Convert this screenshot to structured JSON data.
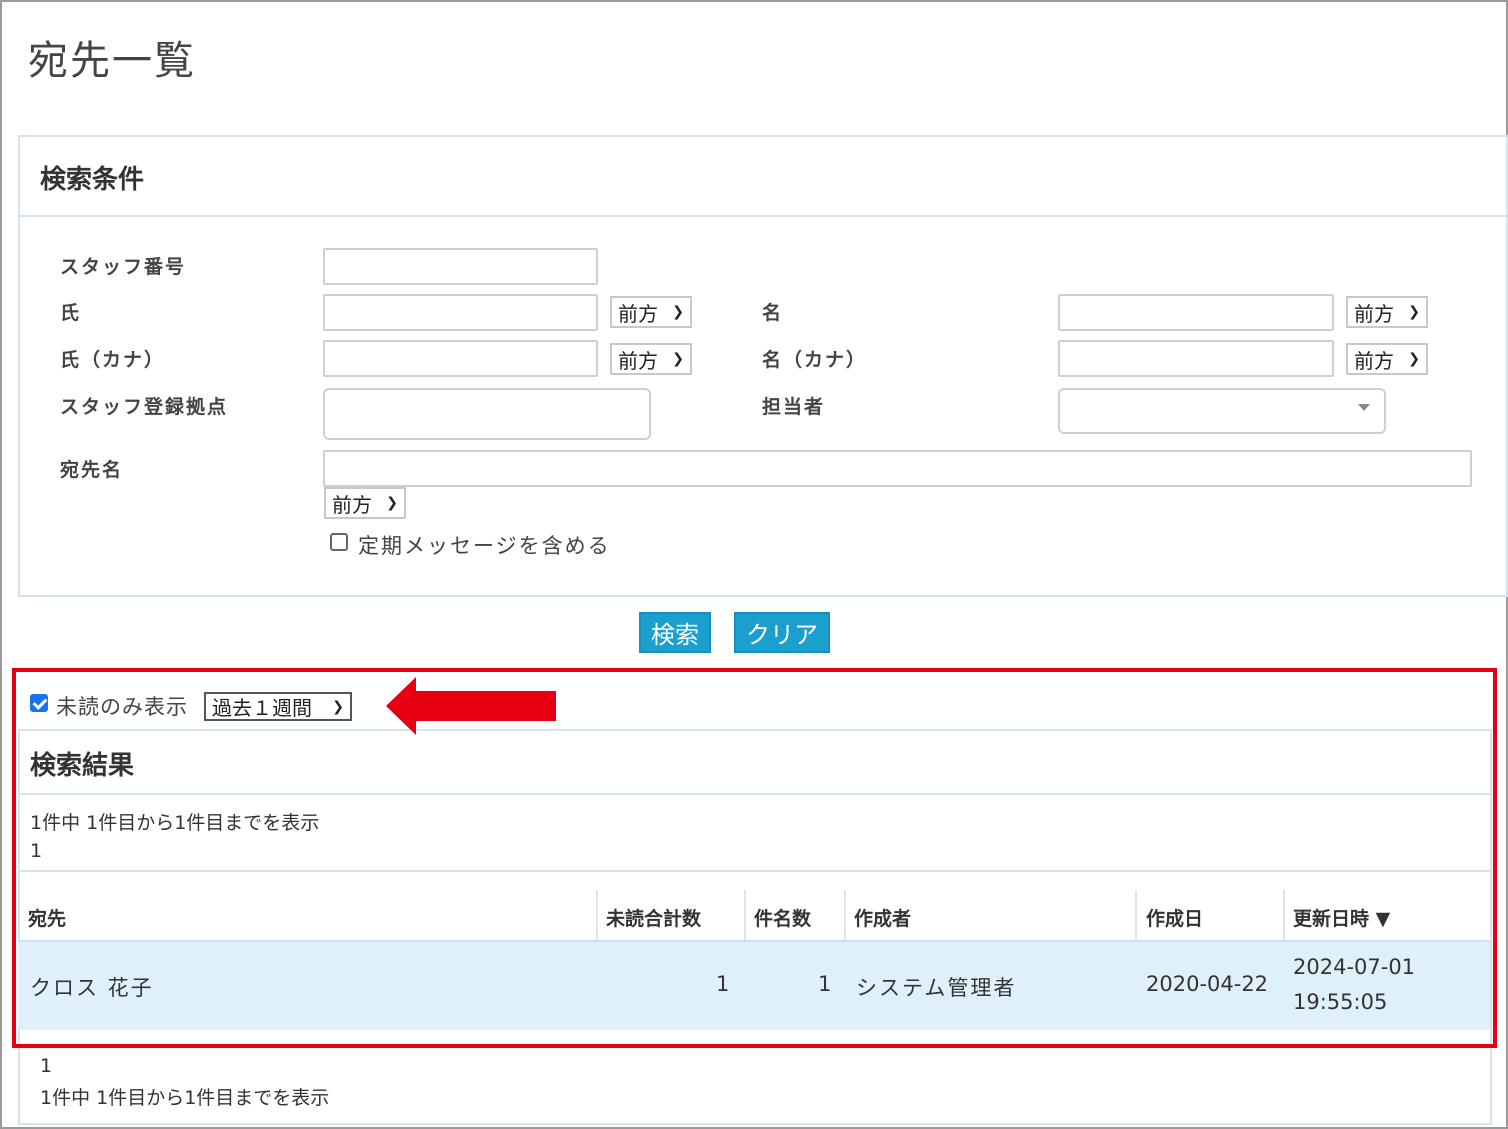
{
  "page": {
    "title": "宛先一覧"
  },
  "search": {
    "title": "検索条件",
    "labels": {
      "staff_no": "スタッフ番号",
      "last_name": "氏",
      "first_name": "名",
      "last_name_kana": "氏（カナ）",
      "first_name_kana": "名（カナ）",
      "staff_base": "スタッフ登録拠点",
      "person_in_charge": "担当者",
      "destination_name": "宛先名"
    },
    "match_option": "前方",
    "include_periodic_label": "定期メッセージを含める",
    "include_periodic_checked": false,
    "search_button": "検索",
    "clear_button": "クリア"
  },
  "filter": {
    "unread_only_label": "未読のみ表示",
    "unread_only_checked": true,
    "period": "過去１週間"
  },
  "results": {
    "title": "検索結果",
    "summary": "1件中 1件目から1件目までを表示",
    "page": "1",
    "columns": [
      "宛先",
      "未読合計数",
      "件名数",
      "作成者",
      "作成日",
      "更新日時 ▼"
    ],
    "rows": [
      {
        "destination": "クロス 花子",
        "unread_total": "1",
        "subject_count": "1",
        "creator": "システム管理者",
        "created": "2020-04-22",
        "updated_date": "2024-07-01",
        "updated_time": "19:55:05"
      }
    ],
    "footer_page": "1",
    "footer_summary": "1件中 1件目から1件目までを表示"
  },
  "colors": {
    "accent": "#1b9fcf",
    "highlight": "#e60012",
    "row_bg": "#dff0fa"
  }
}
